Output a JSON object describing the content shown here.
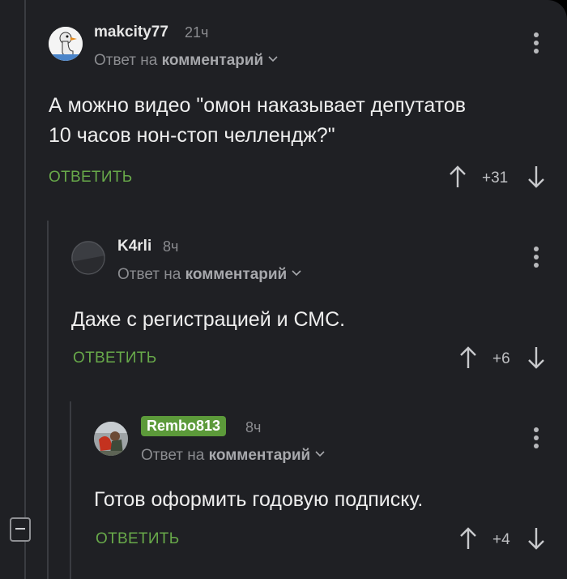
{
  "comments": [
    {
      "username": "makcity77",
      "time": "21ч",
      "reply_prefix": "Ответ на",
      "reply_target": "комментарий",
      "text_line1": "А можно видео \"омон наказывает депутатов",
      "text_line2": "10 часов нон-стоп челлендж?\"",
      "answer_label": "ОТВЕТИТЬ",
      "rating": "+31"
    },
    {
      "username": "K4rli",
      "time": "8ч",
      "reply_prefix": "Ответ на",
      "reply_target": "комментарий",
      "text_line1": "Даже с регистрацией и СМС.",
      "answer_label": "ОТВЕТИТЬ",
      "rating": "+6"
    },
    {
      "username": "Rembo813",
      "time": "8ч",
      "reply_prefix": "Ответ на",
      "reply_target": "комментарий",
      "text_line1": "Готов оформить годовую подписку.",
      "answer_label": "ОТВЕТИТЬ",
      "rating": "+4"
    }
  ],
  "colors": {
    "background": "#1f2024",
    "answer_green": "#68a94a",
    "badge_green": "#5c9a3a",
    "muted_text": "#8b8c90"
  },
  "icons": [
    "collapse-thread-icon",
    "more-vert-icon",
    "arrow-up-icon",
    "arrow-down-icon",
    "chevron-down-icon"
  ]
}
